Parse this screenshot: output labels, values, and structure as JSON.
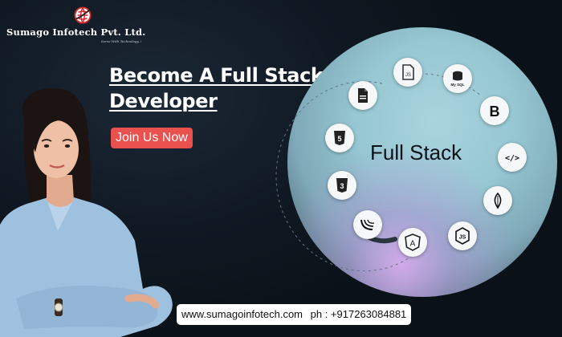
{
  "brand": {
    "company_name": "Sumago Infotech Pvt. Ltd.",
    "tagline": "Serve With Technology..!"
  },
  "hero": {
    "title_line1": "Become A Full Stack",
    "title_line2": "Developer",
    "cta_label": "Join Us Now"
  },
  "circle": {
    "title": "Full Stack",
    "technologies": [
      {
        "name": "javascript",
        "label": "JS"
      },
      {
        "name": "mysql",
        "label": "My SQL"
      },
      {
        "name": "bootstrap",
        "label": "B"
      },
      {
        "name": "code",
        "label": "</>"
      },
      {
        "name": "mongodb",
        "label": ""
      },
      {
        "name": "nodejs",
        "label": "JS"
      },
      {
        "name": "angular",
        "label": "A"
      },
      {
        "name": "jquery",
        "label": ""
      },
      {
        "name": "css3",
        "label": "3"
      },
      {
        "name": "html5",
        "label": "5"
      },
      {
        "name": "document",
        "label": ""
      }
    ]
  },
  "contact": {
    "website": "www.sumagoinfotech.com",
    "phone": "ph : +917263084881"
  },
  "colors": {
    "background": "#0d1520",
    "cta": "#e9514f",
    "brand_red": "#d6262b",
    "circle": "#96c7d2"
  }
}
